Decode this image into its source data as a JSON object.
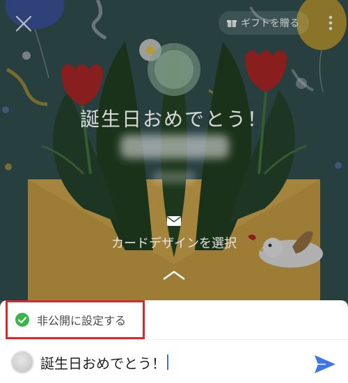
{
  "header": {
    "gift_label": "ギフトを贈る",
    "close_icon": "close-icon",
    "gift_icon": "gift-icon",
    "more_icon": "more-vertical-icon"
  },
  "card": {
    "greeting": "誕生日おめでとう！",
    "design_label": "カードデザインを選択",
    "mail_icon": "mail-icon",
    "expand_icon": "chevron-up-icon"
  },
  "composer": {
    "private_label": "非公開に設定する",
    "private_checked": true,
    "message_value": "誕生日おめでとう！",
    "send_icon": "send-icon"
  },
  "colors": {
    "check_green": "#3bb54a",
    "send_blue": "#3d74e6",
    "highlight_red": "#d8292f",
    "background": "#2f4b4b"
  }
}
